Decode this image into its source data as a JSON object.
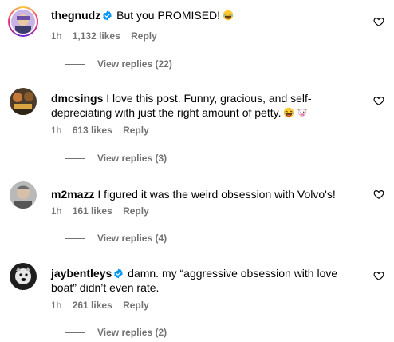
{
  "comments": [
    {
      "username": "thegnudz",
      "verified": true,
      "text": "But you PROMISED!",
      "time": "1h",
      "likes": "1,132 likes",
      "reply_label": "Reply",
      "view_replies": "View replies (22)",
      "emojis": [
        "laughing-emoji"
      ]
    },
    {
      "username": "dmcsings",
      "verified": false,
      "text": "I love this post. Funny, gracious, and self-depreciating with just the right amount of petty.",
      "time": "1h",
      "likes": "613 likes",
      "reply_label": "Reply",
      "view_replies": "View replies (3)",
      "emojis": [
        "laughing-emoji",
        "cow-emoji"
      ]
    },
    {
      "username": "m2mazz",
      "verified": false,
      "text": "I figured it was the weird obsession with Volvo's!",
      "time": "1h",
      "likes": "161 likes",
      "reply_label": "Reply",
      "view_replies": "View replies (4)",
      "emojis": []
    },
    {
      "username": "jaybentleys",
      "verified": true,
      "text": "damn. my “aggressive obsession with love boat” didn’t even rate.",
      "time": "1h",
      "likes": "261 likes",
      "reply_label": "Reply",
      "view_replies": "View replies (2)",
      "emojis": []
    }
  ],
  "colors": {
    "meta": "#737373",
    "verified": "#0095f6"
  }
}
